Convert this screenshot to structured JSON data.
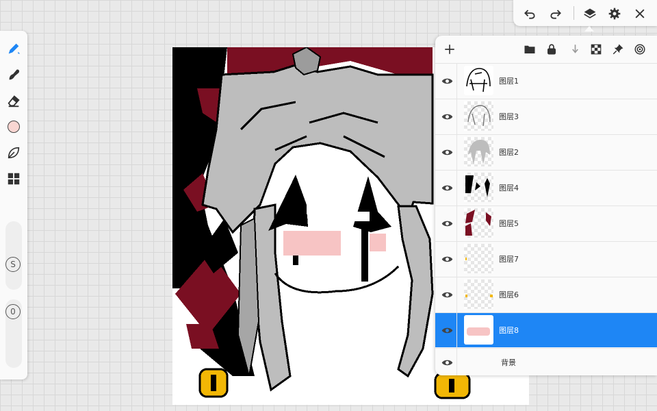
{
  "app": {
    "accent_color": "#1e86f5",
    "canvas_background": "#ffffff"
  },
  "left_toolbar": {
    "tools": [
      {
        "icon": "brush-icon",
        "active": true
      },
      {
        "icon": "smudge-icon"
      },
      {
        "icon": "eraser-icon"
      },
      {
        "icon": "color-swatch",
        "color": "#f9d6d2"
      },
      {
        "icon": "leaf-icon"
      },
      {
        "icon": "grid-icon"
      }
    ],
    "size_label": "S",
    "opacity_label": "0"
  },
  "top_toolbar": {
    "buttons": [
      "undo-icon",
      "redo-icon",
      "layers-icon",
      "settings-icon",
      "close-icon"
    ]
  },
  "layers_panel": {
    "header_icons": [
      "add-icon",
      "folder-icon",
      "lock-icon",
      "merge-down-icon",
      "checker-icon",
      "pin-icon",
      "target-icon"
    ],
    "layers": [
      {
        "name": "图层1",
        "visible": true,
        "selected": false
      },
      {
        "name": "图层3",
        "visible": true,
        "selected": false
      },
      {
        "name": "图层2",
        "visible": true,
        "selected": false
      },
      {
        "name": "图层4",
        "visible": true,
        "selected": false
      },
      {
        "name": "图层5",
        "visible": true,
        "selected": false
      },
      {
        "name": "图层7",
        "visible": true,
        "selected": false
      },
      {
        "name": "图层6",
        "visible": true,
        "selected": false
      },
      {
        "name": "图层8",
        "visible": true,
        "selected": true
      }
    ],
    "background_layer": {
      "name": "背景",
      "visible": true
    }
  },
  "artwork": {
    "colors": {
      "hat_red": "#7a0f22",
      "hair_gray": "#bdbdbd",
      "hair_dark": "#8c8c8c",
      "outline": "#000000",
      "blush": "#f7c4c4",
      "bell_gold": "#f2b705"
    }
  }
}
